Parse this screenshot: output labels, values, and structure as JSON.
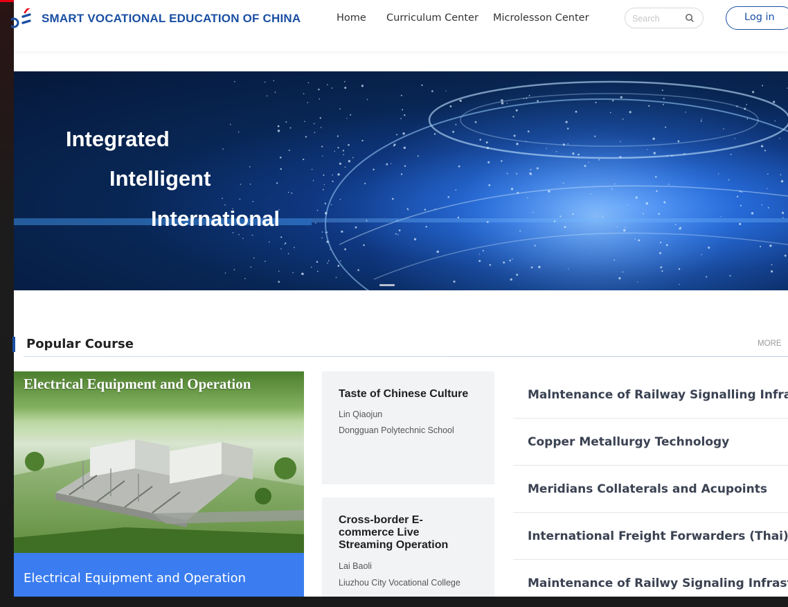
{
  "header": {
    "brand": "SMART VOCATIONAL EDUCATION OF CHINA",
    "nav": [
      "Home",
      "Curriculum Center",
      "Microlesson Center"
    ],
    "search_placeholder": "Search",
    "login_label": "Log in"
  },
  "banner": {
    "taglines": [
      "Integrated",
      "Intelligent",
      "International"
    ]
  },
  "popular": {
    "title": "Popular Course",
    "more_label": "MORE",
    "featured": {
      "image_title": "Electrical Equipment and Operation",
      "caption": "Electrical Equipment and Operation"
    },
    "cards": [
      {
        "title_lines": [
          "Taste of Chinese Culture"
        ],
        "teacher": "Lin Qiaojun",
        "school": "Dongguan Polytechnic School"
      },
      {
        "title_lines": [
          "Cross-border E-",
          "commerce Live",
          "Streaming Operation"
        ],
        "teacher": "Lai Baoli",
        "school": "Liuzhou City Vocational College"
      }
    ],
    "list": [
      "Malntenance of Railway Signalling Infra...",
      "Copper Metallurgy Technology",
      "Meridians Collaterals and Acupoints",
      "International Freight Forwarders (Thai)",
      "Maintenance of Railwy Signaling Infrast..."
    ]
  },
  "colors": {
    "brand_blue": "#1a4fa3",
    "accent_red": "#e60012",
    "caption_blue": "#3b7df0"
  }
}
